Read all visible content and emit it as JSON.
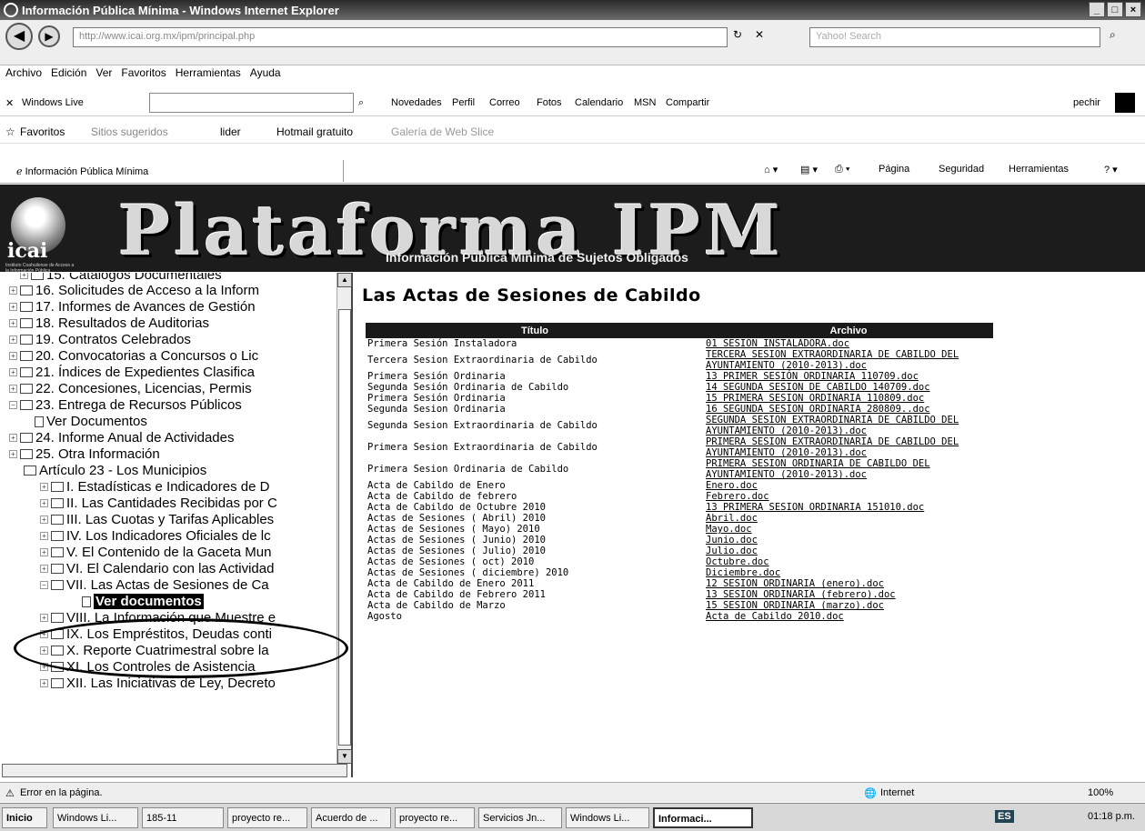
{
  "window": {
    "title": "Información Pública Mínima - Windows Internet Explorer"
  },
  "address": {
    "url": "http://www.icai.org.mx/ipm/principal.php",
    "search_placeholder": "Yahoo! Search"
  },
  "menu": [
    "Archivo",
    "Edición",
    "Ver",
    "Favoritos",
    "Herramientas",
    "Ayuda"
  ],
  "live": {
    "brand": "Windows Live",
    "links": [
      "Novedades",
      "Perfil",
      "Correo",
      "Fotos",
      "Calendario",
      "MSN",
      "Compartir"
    ],
    "user": "pechir"
  },
  "favorites": {
    "label": "Favoritos",
    "items": [
      "Sitios sugeridos",
      "lider",
      "Hotmail gratuito",
      "Galería de Web Slice"
    ]
  },
  "tab": {
    "label": "Información Pública Mínima",
    "commands": [
      "Página",
      "Seguridad",
      "Herramientas"
    ]
  },
  "banner": {
    "logo_text": "icai",
    "logo_sub": "Instituto Coahuilense de Acceso a la Información Pública",
    "title": "Plataforma IPM",
    "subtitle": "Información Pública Mínima de Sujetos Obligados"
  },
  "tree": {
    "items": [
      {
        "label": "15. Catálogos Documentales"
      },
      {
        "label": "16. Solicitudes de Acceso a la Inform"
      },
      {
        "label": "17. Informes de Avances de Gestión"
      },
      {
        "label": "18. Resultados de Auditorias"
      },
      {
        "label": "19. Contratos Celebrados"
      },
      {
        "label": "20. Convocatorias a Concursos o Lic"
      },
      {
        "label": "21. Índices de Expedientes Clasifica"
      },
      {
        "label": "22. Concesiones, Licencias, Permis"
      },
      {
        "label": "23. Entrega de Recursos Públicos"
      },
      {
        "label": "Ver Documentos"
      },
      {
        "label": "24. Informe Anual de Actividades"
      },
      {
        "label": "25. Otra Información"
      },
      {
        "label": "Artículo 23 - Los Municipios"
      },
      {
        "label": "I. Estadísticas e Indicadores de D"
      },
      {
        "label": "II. Las Cantidades Recibidas por C"
      },
      {
        "label": "III. Las Cuotas y Tarifas Aplicables"
      },
      {
        "label": "IV. Los Indicadores Oficiales de lc"
      },
      {
        "label": "V. El Contenido de la Gaceta Mun"
      },
      {
        "label": "VI. El Calendario con las Actividad"
      },
      {
        "label": "VII. Las Actas de Sesiones de Ca"
      },
      {
        "label": "Ver documentos"
      },
      {
        "label": "VIII. La Información que Muestre e"
      },
      {
        "label": "IX. Los Empréstitos, Deudas conti"
      },
      {
        "label": "X. Reporte Cuatrimestral sobre la"
      },
      {
        "label": "XI. Los Controles de Asistencia"
      },
      {
        "label": "XII. Las Iniciativas de Ley, Decreto"
      }
    ]
  },
  "content": {
    "heading": "Las Actas de Sesiones de Cabildo",
    "col_title": "Título",
    "col_file": "Archivo",
    "rows": [
      {
        "title": "Primera Sesión Instaladora",
        "file": "01 SESION INSTALADORA.doc"
      },
      {
        "title": "Tercera Sesion Extraordinaria de Cabildo",
        "file": "TERCERA SESION EXTRAORDINARIA DE CABILDO DEL AYUNTAMIENTO (2010-2013).doc"
      },
      {
        "title": "Primera Sesión Ordinaria",
        "file": "13 PRIMER SESIÓN ORDINARIA 110709.doc"
      },
      {
        "title": "Segunda Sesión Ordinaria de Cabildo",
        "file": "14 SEGUNDA SESION DE CABILDO 140709.doc"
      },
      {
        "title": "Primera Sesión Ordinaria",
        "file": "15 PRIMERA SESION ORDINARIA 110809.doc"
      },
      {
        "title": "Segunda Sesion Ordinaria",
        "file": "16 SEGUNDA SESION ORDINARIA 280809..doc"
      },
      {
        "title": "Segunda Sesion Extraordinaria de Cabildo",
        "file": "SEGUNDA SESION EXTRAORDINARIA DE CABILDO DEL AYUNTAMIENTO (2010-2013).doc"
      },
      {
        "title": "Primera Sesion Extraordinaria de Cabildo",
        "file": "PRIMERA SESION EXTRAORDINARIA DE CABILDO DEL AYUNTAMIENTO (2010-2013).doc"
      },
      {
        "title": "Primera Sesion Ordinaria de Cabildo",
        "file": "PRIMERA SESION ORDINARIA DE CABILDO DEL AYUNTAMIENTO (2010-2013).doc"
      },
      {
        "title": "Acta de Cabildo de Enero",
        "file": "Enero.doc"
      },
      {
        "title": "Acta de Cabildo de febrero",
        "file": "Febrero.doc"
      },
      {
        "title": "Acta de Cabildo de Octubre 2010",
        "file": "13 PRIMERA SESION ORDINARIA 151010.doc"
      },
      {
        "title": "Actas de Sesiones ( Abril) 2010",
        "file": "Abril.doc"
      },
      {
        "title": "Actas de Sesiones ( Mayo) 2010",
        "file": "Mayo.doc"
      },
      {
        "title": "Actas de Sesiones ( Junio) 2010",
        "file": "Junio.doc"
      },
      {
        "title": "Actas de Sesiones ( Julio) 2010",
        "file": "Julio.doc"
      },
      {
        "title": "Actas de Sesiones ( oct) 2010",
        "file": "Octubre.doc"
      },
      {
        "title": "Actas de Sesiones ( diciembre) 2010",
        "file": "Diciembre.doc"
      },
      {
        "title": "Acta de Cabildo de Enero 2011",
        "file": "12 SESION ORDINARIA (enero).doc"
      },
      {
        "title": "Acta de Cabildo de Febrero 2011",
        "file": "13 SESION ORDINARIA (febrero).doc"
      },
      {
        "title": "Acta de Cabildo de Marzo",
        "file": "15 SESION ORDINARIA (marzo).doc"
      },
      {
        "title": "Agosto",
        "file": "Acta de Cabildo 2010.doc"
      }
    ]
  },
  "status": {
    "text": "Error en la página.",
    "zone": "Internet",
    "zoom": "100%"
  },
  "taskbar": {
    "start": "Inicio",
    "tasks": [
      "Windows Li...",
      "185-11",
      "proyecto re...",
      "Acuerdo de ...",
      "proyecto re...",
      "Servicios Jn...",
      "Windows Li...",
      "Informaci..."
    ],
    "lang": "ES",
    "clock": "01:18 p.m."
  }
}
